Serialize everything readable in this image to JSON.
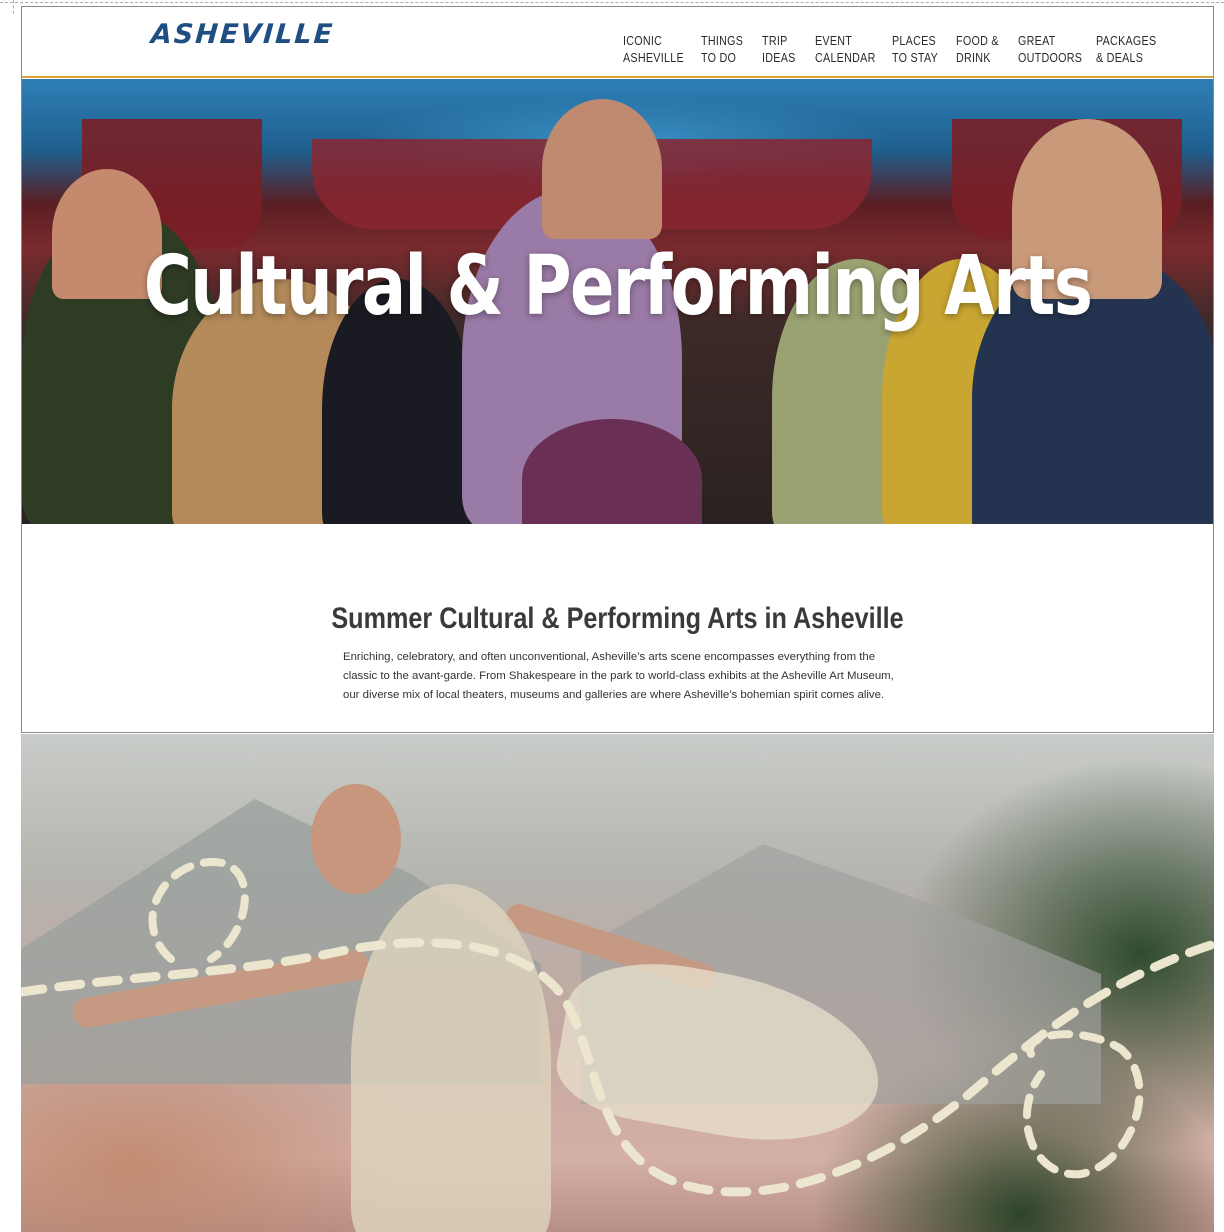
{
  "brand": {
    "logo_text": "ASHEVILLE",
    "logo_color": "#1f4f82"
  },
  "nav": {
    "items": [
      {
        "line1": "ICONIC",
        "line2": "ASHEVILLE"
      },
      {
        "line1": "THINGS",
        "line2": "TO DO"
      },
      {
        "line1": "TRIP",
        "line2": "IDEAS"
      },
      {
        "line1": "EVENT",
        "line2": "CALENDAR"
      },
      {
        "line1": "PLACES",
        "line2": "TO STAY"
      },
      {
        "line1": "FOOD &",
        "line2": "DRINK"
      },
      {
        "line1": "GREAT",
        "line2": "OUTDOORS"
      },
      {
        "line1": "PACKAGES",
        "line2": "& DEALS"
      }
    ]
  },
  "hero": {
    "title": "Cultural & Performing Arts"
  },
  "intro": {
    "heading": "Summer Cultural & Performing Arts in Asheville",
    "body": "Enriching, celebratory, and often unconventional, Asheville’s arts scene encompasses everything from the classic to the avant-garde. From Shakespeare in the park to world-class exhibits at the Asheville Art Museum, our diverse mix of local theaters, museums and galleries are where Asheville’s bohemian spirit comes alive."
  },
  "colors": {
    "accent_line": "#d9a23a",
    "text_dark": "#333333"
  }
}
